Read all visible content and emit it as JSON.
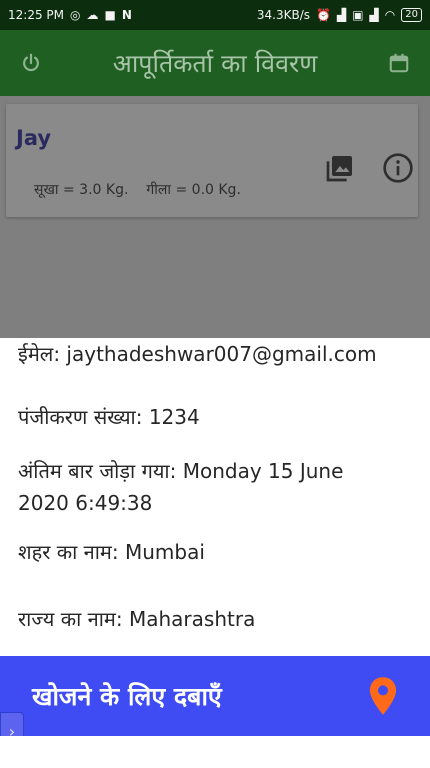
{
  "status_bar": {
    "time": "12:25 PM",
    "network_speed": "34.3KB/s",
    "battery": "20",
    "icons_left": [
      "whatsapp-icon",
      "cloud-icon",
      "video-icon",
      "n-icon"
    ],
    "icons_right": [
      "alarm-icon",
      "signal-icon",
      "volte-icon",
      "signal-icon",
      "wifi-icon",
      "battery-icon"
    ]
  },
  "app_bar": {
    "title": "आपूर्तिकर्ता का विवरण",
    "left_icon": "power-icon",
    "right_icon": "calendar-icon"
  },
  "supplier_card": {
    "name": "Jay",
    "dry_weight": "सूखा = 3.0 Kg.",
    "wet_weight": "गीला = 0.0 Kg.",
    "gallery_icon": "gallery-icon",
    "info_icon": "info-icon"
  },
  "details": {
    "email": "ईमेल: jaythadeshwar007@gmail.com",
    "registration": "पंजीकरण संख्या: 1234",
    "last_added_line1": "अंतिम बार जोड़ा गया: Monday 15 June",
    "last_added_line2": "2020 6:49:38",
    "city": "शहर का नाम: Mumbai",
    "state": "राज्य का नाम: Maharashtra"
  },
  "search_bar": {
    "label": "खोजने के लिए दबाएँ",
    "icon": "location-pin-icon"
  },
  "side_handle": {
    "glyph": "›"
  },
  "colors": {
    "status_bar": "#0c2e0f",
    "app_bar": "#1f5f22",
    "search_bar": "#3f4bf3",
    "pin": "#ff6a1a",
    "card_name": "#2b2a5f"
  }
}
